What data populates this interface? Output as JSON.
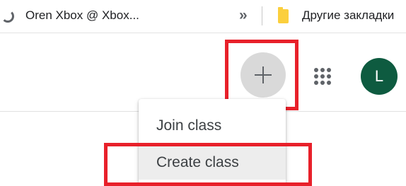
{
  "bookmarks": {
    "first_icon": "circular-arrow-icon",
    "first_label": "Oren Xbox @ Xbox...",
    "overflow_label": "»",
    "folder_icon": "folder-icon",
    "other_label": "Другие закладки"
  },
  "header": {
    "add_icon": "plus-icon",
    "apps_icon": "apps-grid-icon",
    "avatar_initial": "L",
    "avatar_color": "#0e5b40"
  },
  "menu": {
    "items": [
      {
        "label": "Join class"
      },
      {
        "label": "Create class"
      }
    ]
  },
  "highlight_color": "#e8202a"
}
